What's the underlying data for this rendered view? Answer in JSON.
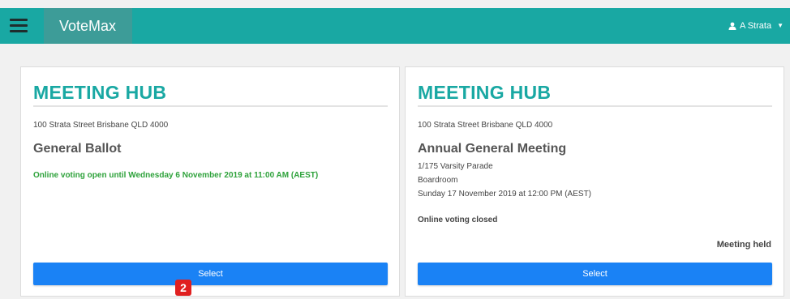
{
  "header": {
    "brand": "VoteMax",
    "user_name": "A Strata",
    "menu_icon": "hamburger-icon",
    "user_icon": "person-icon",
    "colors": {
      "bar": "#19a8a3",
      "brand_bg": "#3d9c98"
    }
  },
  "cards": [
    {
      "title": "MEETING HUB",
      "address": "100 Strata Street Brisbane QLD 4000",
      "meeting": "General Ballot",
      "status": "Online voting open until Wednesday 6 November 2019 at 11:00 AM (AEST)",
      "button": "Select"
    },
    {
      "title": "MEETING HUB",
      "address": "100 Strata Street Brisbane QLD 4000",
      "meeting": "Annual General Meeting",
      "location_line1": "1/175 Varsity Parade",
      "location_line2": "Boardroom",
      "datetime": "Sunday 17 November 2019 at 12:00 PM (AEST)",
      "status": "Online voting closed",
      "held": "Meeting held",
      "button": "Select"
    }
  ],
  "badge": {
    "count": "2",
    "color": "#e02020"
  },
  "accent": {
    "primary_button": "#1a82f5",
    "open_green": "#2ea23b"
  }
}
